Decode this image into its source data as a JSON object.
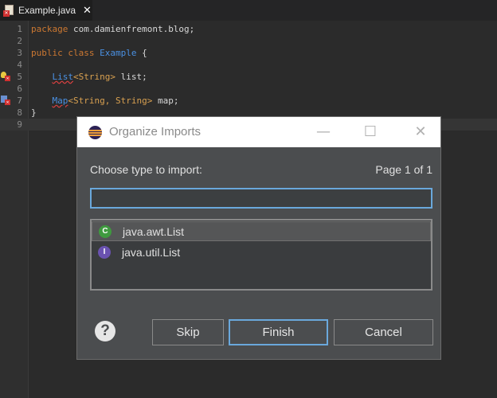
{
  "tab": {
    "label": "Example.java",
    "close_glyph": "✕"
  },
  "editor": {
    "lines": [
      {
        "n": "1",
        "text": "package com.damienfremont.blog;"
      },
      {
        "n": "2",
        "text": ""
      },
      {
        "n": "3",
        "text": "public class Example {"
      },
      {
        "n": "4",
        "text": ""
      },
      {
        "n": "5",
        "text": "    List<String> list;"
      },
      {
        "n": "6",
        "text": ""
      },
      {
        "n": "7",
        "text": "    Map<String, String> map;"
      },
      {
        "n": "8",
        "text": "}"
      },
      {
        "n": "9",
        "text": ""
      }
    ]
  },
  "dialog": {
    "title": "Organize Imports",
    "minimize": "—",
    "maximize": "☐",
    "close": "✕",
    "choose_label": "Choose type to import:",
    "page_label": "Page 1 of 1",
    "search_value": "",
    "items": [
      {
        "badge": "C",
        "badge_color": "#3f9a3f",
        "label": "java.awt.List"
      },
      {
        "badge": "I",
        "badge_color": "#6a52b0",
        "label": "java.util.List"
      }
    ],
    "help_glyph": "?",
    "buttons": {
      "skip": "Skip",
      "finish": "Finish",
      "cancel": "Cancel"
    }
  }
}
